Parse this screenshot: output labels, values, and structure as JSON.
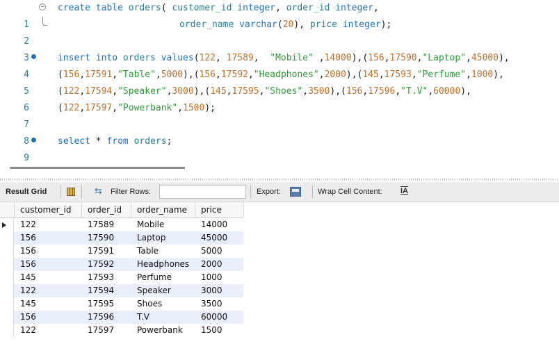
{
  "editor": {
    "line_numbers": [
      "1",
      "2",
      "3",
      "4",
      "5",
      "6",
      "7",
      "8",
      "9"
    ],
    "l1": {
      "kw1": "create table",
      "id1": " orders",
      "p1": "(",
      "id2": " customer_id ",
      "kw2": "integer",
      "p2": ",",
      "id3": " order_id ",
      "kw3": "integer",
      "p3": ","
    },
    "l2": {
      "id1": "order_name ",
      "kw1": "varchar",
      "p1": "(",
      "n1": "20",
      "p2": "),",
      "id2": " price ",
      "kw2": "integer",
      "p3": ");"
    },
    "l4": {
      "kw1": "insert into",
      "id1": " orders ",
      "kw2": "values",
      "p1": "(",
      "n1": "122",
      "p2": ", ",
      "n2": "17589",
      "p3": ",  ",
      "s1": "\"Mobile\"",
      "p4": " ,",
      "n3": "14000",
      "p5": "),(",
      "n4": "156",
      "p6": ",",
      "n5": "17590",
      "p7": ",",
      "s2": "\"Laptop\"",
      "p8": ",",
      "n6": "45000",
      "p9": "),"
    },
    "l5": [
      {
        "n_cid": "156",
        "n_oid": "17591",
        "s": "\"Table\"",
        "n_p": "5000",
        "tail": "),("
      },
      {
        "n_cid": "156",
        "n_oid": "17592",
        "s": "\"Headphones\"",
        "n_p": "2000",
        "tail": "),("
      },
      {
        "n_cid": "145",
        "n_oid": "17593",
        "s": "\"Perfume\"",
        "n_p": "1000",
        "tail": "),"
      }
    ],
    "l6": [
      {
        "n_cid": "122",
        "n_oid": "17594",
        "s": "\"Speaker\"",
        "n_p": "3000",
        "tail": "),("
      },
      {
        "n_cid": "145",
        "n_oid": "17595",
        "s": "\"Shoes\"",
        "n_p": "3500",
        "tail": "),("
      },
      {
        "n_cid": "156",
        "n_oid": "17596",
        "s": "\"T.V\"",
        "n_p": "60000",
        "tail": "),"
      }
    ],
    "l7": {
      "n_cid": "122",
      "n_oid": "17597",
      "s": "\"Powerbank\"",
      "n_p": "1500",
      "tail": ");"
    },
    "l9": {
      "kw1": "select",
      "p1": " * ",
      "kw2": "from",
      "id1": " orders",
      "p2": ";"
    }
  },
  "toolbar": {
    "result_grid_label": "Result Grid",
    "filter_rows_label": "Filter Rows:",
    "filter_rows_value": "",
    "export_label": "Export:",
    "wrap_label": "Wrap Cell Content:",
    "wrap_icon": "IA"
  },
  "grid": {
    "columns": [
      "customer_id",
      "order_id",
      "order_name",
      "price"
    ],
    "rows": [
      [
        "122",
        "17589",
        "Mobile",
        "14000"
      ],
      [
        "156",
        "17590",
        "Laptop",
        "45000"
      ],
      [
        "156",
        "17591",
        "Table",
        "5000"
      ],
      [
        "156",
        "17592",
        "Headphones",
        "2000"
      ],
      [
        "145",
        "17593",
        "Perfume",
        "1000"
      ],
      [
        "122",
        "17594",
        "Speaker",
        "3000"
      ],
      [
        "145",
        "17595",
        "Shoes",
        "3500"
      ],
      [
        "156",
        "17596",
        "T.V",
        "60000"
      ],
      [
        "122",
        "17597",
        "Powerbank",
        "1500"
      ]
    ]
  },
  "colors": {
    "keyword": "#1e72c6",
    "string": "#2f9a39",
    "number": "#c0712b",
    "identifier": "#2a7f93",
    "alt_row": "#e8effa"
  },
  "icons": [
    "fold-icon",
    "statement-dot-icon",
    "grid-icon",
    "filter-icon",
    "export-icon",
    "wrap-icon",
    "row-pointer-icon"
  ]
}
